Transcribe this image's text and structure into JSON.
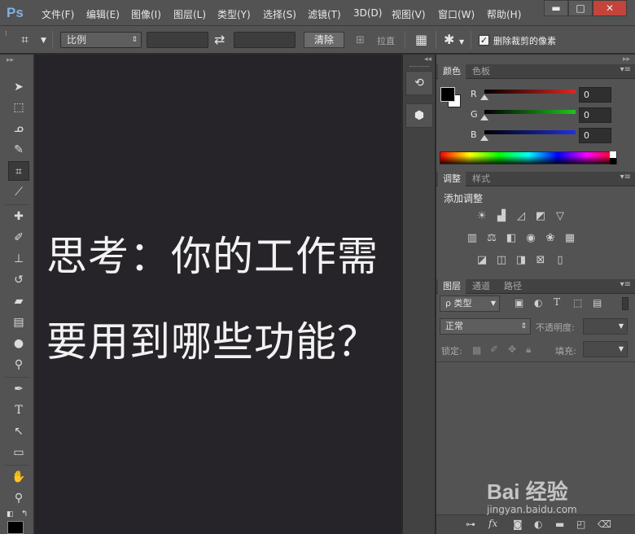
{
  "app": {
    "logo": "Ps",
    "menus": [
      "文件(F)",
      "编辑(E)",
      "图像(I)",
      "图层(L)",
      "类型(Y)",
      "选择(S)",
      "滤镜(T)",
      "3D(D)",
      "视图(V)",
      "窗口(W)",
      "帮助(H)"
    ],
    "window_controls": {
      "minimize": "▬",
      "maximize": "□",
      "close": "✕"
    }
  },
  "options_bar": {
    "ratio_select": "比例",
    "width_value": "",
    "height_value": "",
    "swap_icon": "⇄",
    "clear_button": "清除",
    "straighten_label": "拉直",
    "delete_cropped_label": "删除裁剪的像素",
    "delete_cropped_checked": true
  },
  "canvas": {
    "line1": "思考：你的工作需",
    "line2": "要用到哪些功能？",
    "text_color": "#f2f2f2",
    "background": "#262428"
  },
  "color_panel": {
    "tabs": [
      "颜色",
      "色板"
    ],
    "channels": [
      {
        "label": "R",
        "value": "0",
        "color": "#e0261f"
      },
      {
        "label": "G",
        "value": "0",
        "color": "#1fc41f"
      },
      {
        "label": "B",
        "value": "0",
        "color": "#1f2fe0"
      }
    ]
  },
  "adjustments_panel": {
    "tabs": [
      "调整",
      "样式"
    ],
    "heading": "添加调整"
  },
  "layers_panel": {
    "tabs": [
      "图层",
      "通道",
      "路径"
    ],
    "filter_kind": "ρ 类型",
    "blend_mode": "正常",
    "opacity_label": "不透明度:",
    "lock_label": "锁定:",
    "fill_label": "填充:"
  },
  "watermark": {
    "text": "Bai 经验",
    "url": "jingyan.baidu.com"
  }
}
